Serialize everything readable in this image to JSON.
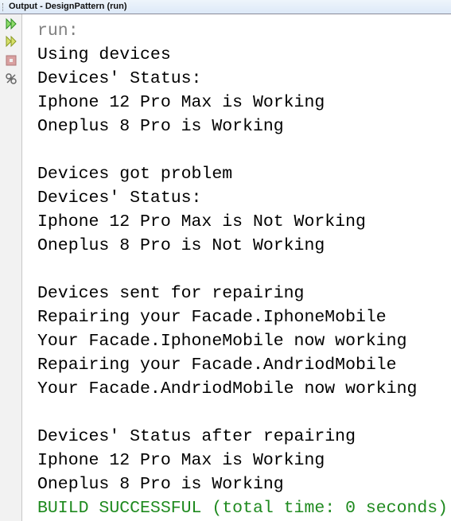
{
  "window": {
    "title": "Output - DesignPattern (run)"
  },
  "toolbar": {
    "icons": [
      "rerun-icon",
      "rerun-with-options-icon",
      "stop-icon",
      "settings-icon"
    ]
  },
  "colors": {
    "run_text": "#808080",
    "build_success": "#1f8a1f"
  },
  "console": {
    "lines": [
      {
        "text": "run:",
        "style": "gray"
      },
      {
        "text": "Using devices",
        "style": "normal"
      },
      {
        "text": "Devices' Status:",
        "style": "normal"
      },
      {
        "text": "Iphone 12 Pro Max is Working",
        "style": "normal"
      },
      {
        "text": "Oneplus 8 Pro is Working",
        "style": "normal"
      },
      {
        "text": "",
        "style": "normal"
      },
      {
        "text": "Devices got problem",
        "style": "normal"
      },
      {
        "text": "Devices' Status:",
        "style": "normal"
      },
      {
        "text": "Iphone 12 Pro Max is Not Working",
        "style": "normal"
      },
      {
        "text": "Oneplus 8 Pro is Not Working",
        "style": "normal"
      },
      {
        "text": "",
        "style": "normal"
      },
      {
        "text": "Devices sent for repairing",
        "style": "normal"
      },
      {
        "text": "Repairing your Facade.IphoneMobile",
        "style": "normal"
      },
      {
        "text": "Your Facade.IphoneMobile now working",
        "style": "normal"
      },
      {
        "text": "Repairing your Facade.AndriodMobile",
        "style": "normal"
      },
      {
        "text": "Your Facade.AndriodMobile now working",
        "style": "normal"
      },
      {
        "text": "",
        "style": "normal"
      },
      {
        "text": "Devices' Status after repairing",
        "style": "normal"
      },
      {
        "text": "Iphone 12 Pro Max is Working",
        "style": "normal"
      },
      {
        "text": "Oneplus 8 Pro is Working",
        "style": "normal"
      },
      {
        "text": "BUILD SUCCESSFUL (total time: 0 seconds)",
        "style": "green"
      }
    ]
  }
}
